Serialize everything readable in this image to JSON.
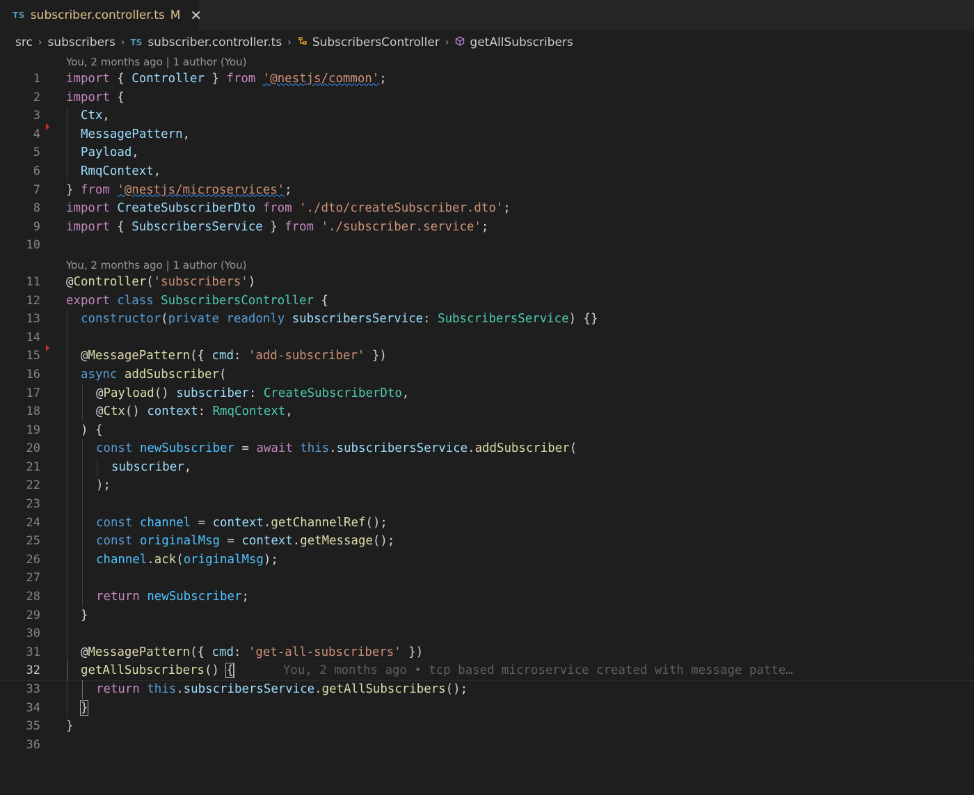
{
  "tab": {
    "badge": "TS",
    "title": "subscriber.controller.ts",
    "modified": "M",
    "close": "✕"
  },
  "breadcrumb": {
    "items": [
      "src",
      "subscribers",
      "subscriber.controller.ts",
      "SubscribersController",
      "getAllSubscribers"
    ],
    "ts_badge": "TS",
    "separator": "›"
  },
  "codelens": {
    "top": "You, 2 months ago | 1 author (You)",
    "class": "You, 2 months ago | 1 author (You)"
  },
  "blame": "You, 2 months ago • tcp based microservice created with message patte…",
  "line_numbers": [
    "1",
    "2",
    "3",
    "4",
    "5",
    "6",
    "7",
    "8",
    "9",
    "10",
    "11",
    "12",
    "13",
    "14",
    "15",
    "16",
    "17",
    "18",
    "19",
    "20",
    "21",
    "22",
    "23",
    "24",
    "25",
    "26",
    "27",
    "28",
    "29",
    "30",
    "31",
    "32",
    "33",
    "34",
    "35",
    "36"
  ],
  "lines": {
    "l1": [
      "import",
      " { ",
      "Controller",
      " } ",
      "from",
      " ",
      "'@nestjs/common'",
      ";"
    ],
    "l2": [
      "import",
      " {"
    ],
    "l3": [
      "Ctx",
      ","
    ],
    "l4": [
      "MessagePattern",
      ","
    ],
    "l5": [
      "Payload",
      ","
    ],
    "l6": [
      "RmqContext",
      ","
    ],
    "l7": [
      "} ",
      "from",
      " ",
      "'@nestjs/microservices'",
      ";"
    ],
    "l8": [
      "import",
      " ",
      "CreateSubscriberDto",
      " ",
      "from",
      " ",
      "'./dto/createSubscriber.dto'",
      ";"
    ],
    "l9": [
      "import",
      " { ",
      "SubscribersService",
      " } ",
      "from",
      " ",
      "'./subscriber.service'",
      ";"
    ],
    "l11": [
      "@",
      "Controller",
      "(",
      "'subscribers'",
      ")"
    ],
    "l12": [
      "export",
      " ",
      "class",
      " ",
      "SubscribersController",
      " {"
    ],
    "l13": [
      "constructor",
      "(",
      "private",
      " ",
      "readonly",
      " ",
      "subscribersService",
      ": ",
      "SubscribersService",
      ") {}"
    ],
    "l15": [
      "@",
      "MessagePattern",
      "({ ",
      "cmd",
      ": ",
      "'add-subscriber'",
      " })"
    ],
    "l16": [
      "async",
      " ",
      "addSubscriber",
      "("
    ],
    "l17": [
      "@",
      "Payload",
      "() ",
      "subscriber",
      ": ",
      "CreateSubscriberDto",
      ","
    ],
    "l18": [
      "@",
      "Ctx",
      "() ",
      "context",
      ": ",
      "RmqContext",
      ","
    ],
    "l19": [
      ") {"
    ],
    "l20": [
      "const",
      " ",
      "newSubscriber",
      " = ",
      "await",
      " ",
      "this",
      ".",
      "subscribersService",
      ".",
      "addSubscriber",
      "("
    ],
    "l21": [
      "subscriber",
      ","
    ],
    "l22": [
      ");"
    ],
    "l24": [
      "const",
      " ",
      "channel",
      " = ",
      "context",
      ".",
      "getChannelRef",
      "();"
    ],
    "l25": [
      "const",
      " ",
      "originalMsg",
      " = ",
      "context",
      ".",
      "getMessage",
      "();"
    ],
    "l26": [
      "channel",
      ".",
      "ack",
      "(",
      "originalMsg",
      ");"
    ],
    "l28": [
      "return",
      " ",
      "newSubscriber",
      ";"
    ],
    "l29": [
      "}"
    ],
    "l31": [
      "@",
      "MessagePattern",
      "({ ",
      "cmd",
      ": ",
      "'get-all-subscribers'",
      " })"
    ],
    "l32": [
      "getAllSubscribers",
      "() ",
      "{"
    ],
    "l33": [
      "return",
      " ",
      "this",
      ".",
      "subscribersService",
      ".",
      "getAllSubscribers",
      "();"
    ],
    "l34": [
      "}"
    ],
    "l35": [
      "}"
    ]
  }
}
